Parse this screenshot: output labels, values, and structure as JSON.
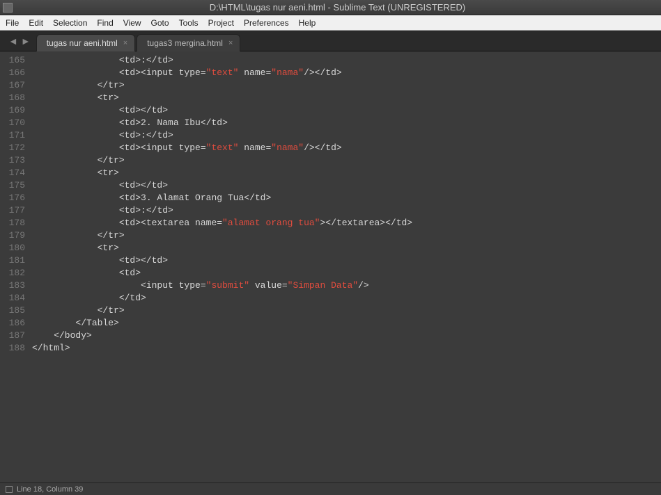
{
  "window": {
    "title": "D:\\HTML\\tugas nur aeni.html - Sublime Text (UNREGISTERED)"
  },
  "menu": {
    "file": "File",
    "edit": "Edit",
    "selection": "Selection",
    "find": "Find",
    "view": "View",
    "goto": "Goto",
    "tools": "Tools",
    "project": "Project",
    "preferences": "Preferences",
    "help": "Help"
  },
  "tabs": [
    {
      "label": "tugas nur aeni.html",
      "active": true
    },
    {
      "label": "tugas3 mergina.html",
      "active": false
    }
  ],
  "gutter": {
    "start": 165,
    "end": 188,
    "numbers": [
      "165",
      "166",
      "167",
      "168",
      "169",
      "170",
      "171",
      "172",
      "173",
      "174",
      "175",
      "176",
      "177",
      "178",
      "179",
      "180",
      "181",
      "182",
      "183",
      "184",
      "185",
      "186",
      "187",
      "188"
    ]
  },
  "code": {
    "lines": [
      {
        "frag": [
          {
            "t": "tag",
            "v": "                <td>"
          },
          {
            "t": "text",
            "v": ":"
          },
          {
            "t": "tag",
            "v": "</td>"
          }
        ]
      },
      {
        "frag": [
          {
            "t": "tag",
            "v": "                <td><input type="
          },
          {
            "t": "str",
            "v": "\"text\""
          },
          {
            "t": "tag",
            "v": " name="
          },
          {
            "t": "str",
            "v": "\"nama\""
          },
          {
            "t": "tag",
            "v": "/></td>"
          }
        ]
      },
      {
        "frag": [
          {
            "t": "tag",
            "v": "            </tr>"
          }
        ]
      },
      {
        "frag": [
          {
            "t": "tag",
            "v": "            <tr>"
          }
        ]
      },
      {
        "frag": [
          {
            "t": "tag",
            "v": "                <td></td>"
          }
        ]
      },
      {
        "frag": [
          {
            "t": "tag",
            "v": "                <td>"
          },
          {
            "t": "text",
            "v": "2. Nama Ibu"
          },
          {
            "t": "tag",
            "v": "</td>"
          }
        ]
      },
      {
        "frag": [
          {
            "t": "tag",
            "v": "                <td>"
          },
          {
            "t": "text",
            "v": ":"
          },
          {
            "t": "tag",
            "v": "</td>"
          }
        ]
      },
      {
        "frag": [
          {
            "t": "tag",
            "v": "                <td><input type="
          },
          {
            "t": "str",
            "v": "\"text\""
          },
          {
            "t": "tag",
            "v": " name="
          },
          {
            "t": "str",
            "v": "\"nama\""
          },
          {
            "t": "tag",
            "v": "/></td>"
          }
        ]
      },
      {
        "frag": [
          {
            "t": "tag",
            "v": "            </tr>"
          }
        ]
      },
      {
        "frag": [
          {
            "t": "tag",
            "v": "            <tr>"
          }
        ]
      },
      {
        "frag": [
          {
            "t": "tag",
            "v": "                <td></td>"
          }
        ]
      },
      {
        "frag": [
          {
            "t": "tag",
            "v": "                <td>"
          },
          {
            "t": "text",
            "v": "3. Alamat Orang Tua"
          },
          {
            "t": "tag",
            "v": "</td>"
          }
        ]
      },
      {
        "frag": [
          {
            "t": "tag",
            "v": "                <td>"
          },
          {
            "t": "text",
            "v": ":"
          },
          {
            "t": "tag",
            "v": "</td>"
          }
        ]
      },
      {
        "frag": [
          {
            "t": "tag",
            "v": "                <td><textarea name="
          },
          {
            "t": "str",
            "v": "\"alamat orang tua\""
          },
          {
            "t": "tag",
            "v": "></textarea></td>"
          }
        ]
      },
      {
        "frag": [
          {
            "t": "tag",
            "v": "            </tr>"
          }
        ]
      },
      {
        "frag": [
          {
            "t": "tag",
            "v": "            <tr>"
          }
        ]
      },
      {
        "frag": [
          {
            "t": "tag",
            "v": "                <td></td>"
          }
        ]
      },
      {
        "frag": [
          {
            "t": "tag",
            "v": "                <td>"
          }
        ]
      },
      {
        "frag": [
          {
            "t": "tag",
            "v": "                    <input type="
          },
          {
            "t": "str",
            "v": "\"submit\""
          },
          {
            "t": "tag",
            "v": " value="
          },
          {
            "t": "str",
            "v": "\"Simpan Data\""
          },
          {
            "t": "tag",
            "v": "/>"
          }
        ]
      },
      {
        "frag": [
          {
            "t": "tag",
            "v": "                </td>"
          }
        ]
      },
      {
        "frag": [
          {
            "t": "tag",
            "v": "            </tr>"
          }
        ]
      },
      {
        "frag": [
          {
            "t": "tag",
            "v": "        </Table>"
          }
        ]
      },
      {
        "frag": [
          {
            "t": "tag",
            "v": "    </body>"
          }
        ]
      },
      {
        "frag": [
          {
            "t": "tag",
            "v": "</html>"
          }
        ]
      }
    ]
  },
  "status": {
    "text": "Line 18, Column 39"
  }
}
